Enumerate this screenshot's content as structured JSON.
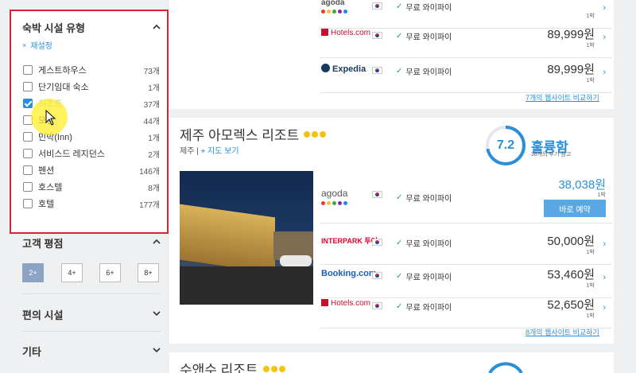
{
  "sidebar": {
    "accommodation": {
      "title": "숙박 시설 유형",
      "reset": "재설정",
      "options": [
        {
          "label": "게스트하우스",
          "count": "73개",
          "checked": false
        },
        {
          "label": "단기임대 숙소",
          "count": "1개",
          "checked": false
        },
        {
          "label": "리조트",
          "count": "37개",
          "checked": true
        },
        {
          "label": "모텔",
          "count": "44개",
          "checked": false
        },
        {
          "label": "민박(Inn)",
          "count": "1개",
          "checked": false
        },
        {
          "label": "서비스드 레지던스",
          "count": "2개",
          "checked": false
        },
        {
          "label": "펜션",
          "count": "146개",
          "checked": false
        },
        {
          "label": "호스텔",
          "count": "8개",
          "checked": false
        },
        {
          "label": "호텔",
          "count": "177개",
          "checked": false
        }
      ]
    },
    "rating": {
      "title": "고객 평점",
      "buttons": [
        "2+",
        "4+",
        "6+",
        "8+"
      ],
      "active": "2+"
    },
    "amenities": {
      "title": "편의 시설"
    },
    "other": {
      "title": "기타"
    }
  },
  "hotel0": {
    "offers": [
      {
        "partner": "agoda",
        "wifi": "무료 와이파이",
        "price": "",
        "night": "1박"
      },
      {
        "partner": "Hotels.com",
        "wifi": "무료 와이파이",
        "price": "89,999원",
        "night": "1박"
      },
      {
        "partner": "Expedia",
        "wifi": "무료 와이파이",
        "price": "89,999원",
        "night": "1박"
      }
    ],
    "compare": "7개의 웹사이트 비교하기"
  },
  "hotel1": {
    "name": "제주 아모렉스 리조트",
    "location": "제주",
    "map_link": "지도 보기",
    "score": "7.2",
    "score_label": "훌륭함",
    "reviews": "38개의 후기 참고",
    "book": "바로 예약",
    "offers": [
      {
        "partner": "agoda",
        "wifi": "무료 와이파이",
        "price": "38,038원",
        "night": "1박"
      },
      {
        "partner": "INTERPARK 투어",
        "wifi": "무료 와이파이",
        "price": "50,000원",
        "night": "1박"
      },
      {
        "partner": "Booking.com",
        "wifi": "무료 와이파이",
        "price": "53,460원",
        "night": "1박"
      },
      {
        "partner": "Hotels.com",
        "wifi": "무료 와이파이",
        "price": "52,650원",
        "night": "1박"
      }
    ],
    "compare": "8개의 웹사이트 비교하기"
  },
  "hotel2": {
    "name": "수앤수 리조트"
  },
  "colors": {
    "accent": "#2a8fd8",
    "highlight_border": "#d7262c",
    "star": "#f4c20d",
    "book": "#59a8e4"
  }
}
